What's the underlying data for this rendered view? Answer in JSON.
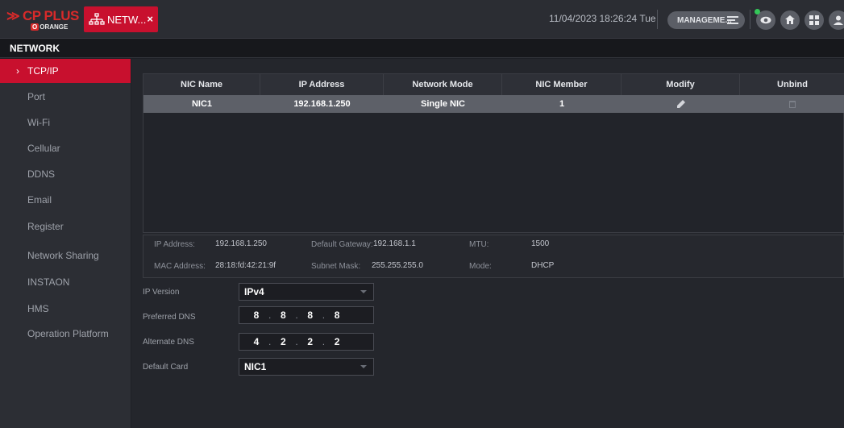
{
  "header": {
    "logo_brand": "CP PLUS",
    "logo_sub": "ORANGE",
    "tab_label": "NETW...",
    "tab_close": "×",
    "datetime": "11/04/2023 18:26:24 Tue",
    "management_label": "MANAGEME...",
    "icons": [
      "eye-icon",
      "home-icon",
      "grid-icon",
      "user-icon"
    ]
  },
  "page_title": "NETWORK",
  "sidebar": {
    "items": [
      {
        "label": "TCP/IP",
        "active": true
      },
      {
        "label": "Port",
        "active": false
      },
      {
        "label": "Wi-Fi",
        "active": false
      },
      {
        "label": "Cellular",
        "active": false
      },
      {
        "label": "DDNS",
        "active": false
      },
      {
        "label": "Email",
        "active": false
      },
      {
        "label": "Register",
        "active": false
      },
      {
        "label": "Network Sharing",
        "active": false
      },
      {
        "label": "INSTAON",
        "active": false
      },
      {
        "label": "HMS",
        "active": false
      },
      {
        "label": "Operation Platform",
        "active": false
      }
    ]
  },
  "nic_table": {
    "columns": [
      "NIC Name",
      "IP Address",
      "Network Mode",
      "NIC Member",
      "Modify",
      "Unbind"
    ],
    "rows": [
      {
        "nic_name": "NIC1",
        "ip_address": "192.168.1.250",
        "network_mode": "Single NIC",
        "nic_member": "1"
      }
    ]
  },
  "details": {
    "ip_address_label": "IP Address:",
    "ip_address": "192.168.1.250",
    "gateway_label": "Default Gateway:",
    "gateway": "192.168.1.1",
    "mtu_label": "MTU:",
    "mtu": "1500",
    "mac_label": "MAC Address:",
    "mac": "28:18:fd:42:21:9f",
    "subnet_label": "Subnet Mask:",
    "subnet": "255.255.255.0",
    "mode_label": "Mode:",
    "mode": "DHCP"
  },
  "form": {
    "ip_version_label": "IP Version",
    "ip_version": "IPv4",
    "preferred_dns_label": "Preferred DNS",
    "preferred_dns": [
      "8",
      "8",
      "8",
      "8"
    ],
    "alternate_dns_label": "Alternate DNS",
    "alternate_dns": [
      "4",
      "2",
      "2",
      "2"
    ],
    "default_card_label": "Default Card",
    "default_card": "NIC1"
  },
  "colors": {
    "accent": "#c8102e",
    "background": "#24262c",
    "sidebar": "#2c2e34",
    "selected_row": "#5d6068"
  }
}
